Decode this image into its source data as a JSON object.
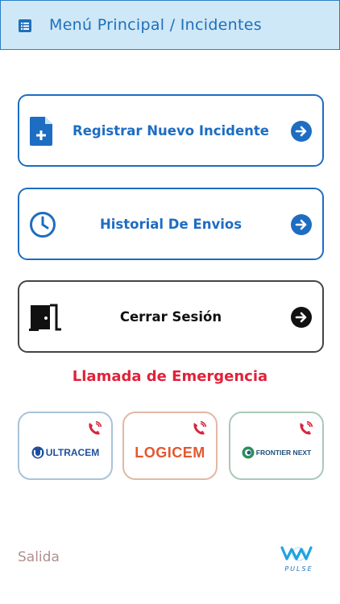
{
  "header": {
    "title": "Menú Principal / Incidentes",
    "menu_icon": "list-icon"
  },
  "menu": [
    {
      "label": "Registrar Nuevo Incidente",
      "icon": "file-plus-icon"
    },
    {
      "label": "Historial De Envios",
      "icon": "clock-icon"
    },
    {
      "label": "Cerrar Sesión",
      "icon": "door-exit-icon"
    }
  ],
  "emergency": {
    "title": "Llamada de Emergencia"
  },
  "brands": [
    {
      "name": "ULTRACEM"
    },
    {
      "name": "LOGICEM"
    },
    {
      "name": "FRONTIER NEXT"
    }
  ],
  "footer": {
    "exit": "Salida",
    "pulse": "PULSE"
  },
  "colors": {
    "primary": "#1d6dc2",
    "emergency": "#e0223a",
    "header_bg": "#cfe8f7"
  }
}
